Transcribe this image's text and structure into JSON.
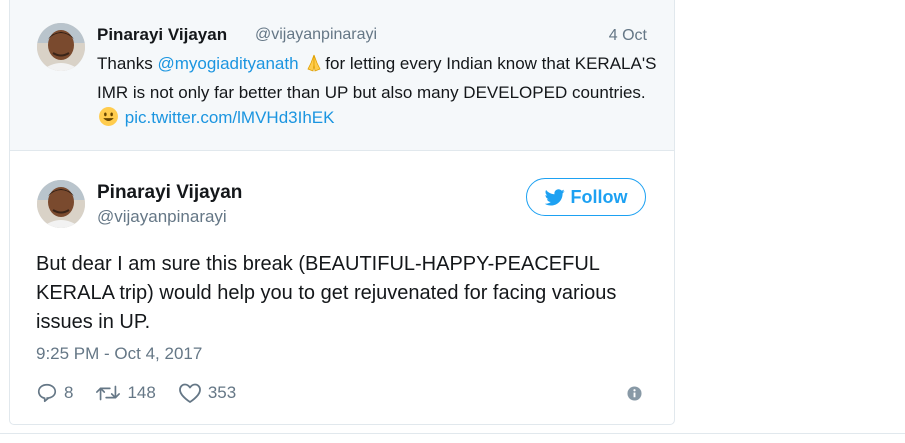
{
  "quoted_tweet": {
    "name": "Pinarayi Vijayan",
    "handle": "@vijayanpinarayi",
    "date": "4 Oct",
    "text_before": "Thanks ",
    "mention": "@myogiadityanath",
    "emoji1": "folded-hands-emoji",
    "text_middle": "for letting every Indian know that KERALA'S IMR is not only far better than UP but also many DEVELOPED countries.",
    "emoji2": "grinning-face-emoji",
    "link": "pic.twitter.com/lMVHd3IhEK"
  },
  "main_tweet": {
    "name": "Pinarayi Vijayan",
    "handle": "@vijayanpinarayi",
    "follow_label": "Follow",
    "text": "But dear I am sure this break (BEAUTIFUL-HAPPY-PEACEFUL KERALA trip) would help you to get rejuvenated for facing various issues in UP.",
    "timestamp": "9:25 PM - Oct 4, 2017",
    "replies": "8",
    "retweets": "148",
    "likes": "353"
  },
  "colors": {
    "link": "#1b95e0",
    "follow": "#1da1f2",
    "muted": "#657786",
    "quoted_bg": "#f5f8fa"
  }
}
